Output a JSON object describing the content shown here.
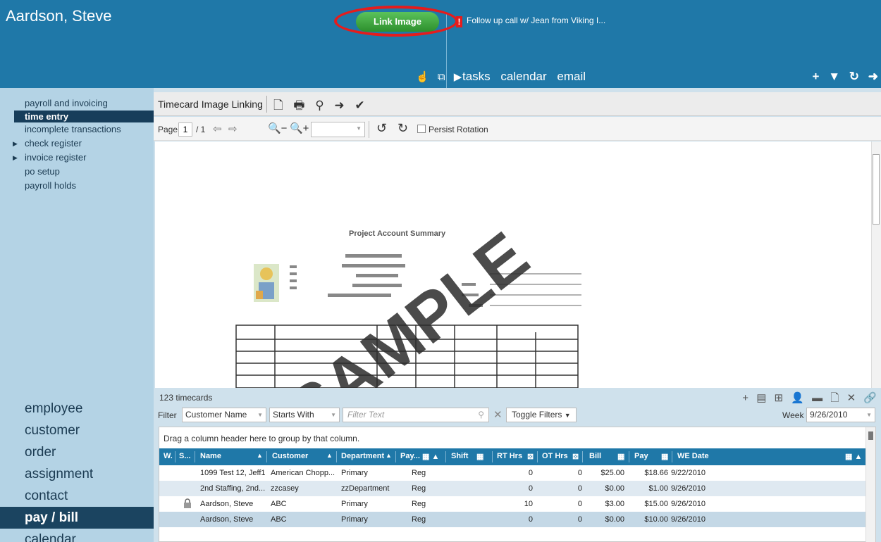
{
  "header": {
    "user_name": "Aardson, Steve",
    "link_image_label": "Link Image",
    "alert_mark": "!",
    "alert_text": "Follow up call w/ Jean from Viking I...",
    "tabs": [
      "tasks",
      "calendar",
      "email"
    ]
  },
  "sidebar": {
    "items": [
      {
        "label": "payroll and invoicing"
      },
      {
        "label": "time entry",
        "active": true
      },
      {
        "label": "incomplete transactions"
      },
      {
        "label": "check register",
        "expandable": true
      },
      {
        "label": "invoice register",
        "expandable": true
      },
      {
        "label": "po setup"
      },
      {
        "label": "payroll holds"
      }
    ],
    "main_nav": [
      {
        "label": "employee"
      },
      {
        "label": "customer"
      },
      {
        "label": "order"
      },
      {
        "label": "assignment"
      },
      {
        "label": "contact"
      },
      {
        "label": "pay / bill",
        "active": true
      },
      {
        "label": "calendar"
      }
    ]
  },
  "viewer": {
    "title": "Timecard Image Linking",
    "page_label": "Page",
    "page_value": "1",
    "page_total": "/ 1",
    "persist_rotation_label": "Persist Rotation",
    "persist_rotation_checked": false,
    "sample_doc": {
      "watermark": "SAMPLE",
      "heading": "Project Account Summary"
    }
  },
  "timecards": {
    "count_label": "123 timecards",
    "filter_label": "Filter",
    "filter_field": "Customer Name",
    "filter_operator": "Starts With",
    "filter_text_placeholder": "Filter Text",
    "toggle_filters_label": "Toggle Filters",
    "week_label": "Week",
    "week_value": "9/26/2010",
    "group_hint": "Drag a column header here to group by that column.",
    "columns": [
      "W.",
      "S...",
      "Name",
      "Customer",
      "Department",
      "Pay...",
      "Shift",
      "RT Hrs",
      "OT Hrs",
      "Bill",
      "Pay",
      "WE Date"
    ],
    "rows": [
      {
        "name": "1099 Test 12, Jeff1",
        "customer": "American Chopp...",
        "department": "Primary",
        "pay_type": "Reg",
        "rt_hrs": "0",
        "ot_hrs": "0",
        "bill": "$25.00",
        "pay": "$18.66",
        "we_date": "9/22/2010",
        "locked": false
      },
      {
        "name": "2nd Staffing, 2nd...",
        "customer": "zzcasey",
        "department": "zzDepartment",
        "pay_type": "Reg",
        "rt_hrs": "0",
        "ot_hrs": "0",
        "bill": "$0.00",
        "pay": "$1.00",
        "we_date": "9/26/2010",
        "locked": false
      },
      {
        "name": "Aardson, Steve",
        "customer": "ABC",
        "department": "Primary",
        "pay_type": "Reg",
        "rt_hrs": "10",
        "ot_hrs": "0",
        "bill": "$3.00",
        "pay": "$15.00",
        "we_date": "9/26/2010",
        "locked": true
      },
      {
        "name": "Aardson, Steve",
        "customer": "ABC",
        "department": "Primary",
        "pay_type": "Reg",
        "rt_hrs": "0",
        "ot_hrs": "0",
        "bill": "$0.00",
        "pay": "$10.00",
        "we_date": "9/26/2010",
        "locked": false
      }
    ]
  },
  "colors": {
    "header_blue": "#1f78a8",
    "sidebar_bg": "#b4d3e5",
    "sidebar_active": "#173d5a",
    "link_button_green": "#2d8f2d",
    "highlight_red": "#e51c1c"
  },
  "icons": [
    "hand-pointer-icon",
    "popout-icon",
    "play-icon",
    "plus-icon",
    "filter-icon",
    "refresh-icon",
    "arrow-right-icon",
    "new-document-icon",
    "printer-icon",
    "search-icon",
    "check-icon",
    "zoom-out-icon",
    "zoom-in-icon",
    "rotate-left-icon",
    "rotate-right-icon",
    "lock-icon",
    "link-icon"
  ]
}
